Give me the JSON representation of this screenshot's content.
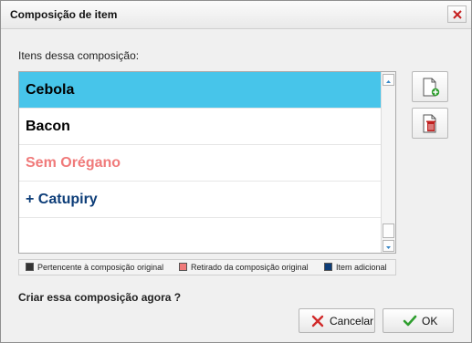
{
  "window": {
    "title": "Composição de item"
  },
  "list": {
    "caption": "Itens dessa composição:",
    "items": [
      {
        "label": "Cebola",
        "selected": true,
        "color": "#000000"
      },
      {
        "label": "Bacon",
        "selected": false,
        "color": "#000000"
      },
      {
        "label": "Sem Orégano",
        "selected": false,
        "color": "#f07a7a"
      },
      {
        "label": "+ Catupiry",
        "selected": false,
        "color": "#0d3d78"
      }
    ],
    "selected_color": "#47c5ea"
  },
  "legend": [
    {
      "label": "Pertencente à composição original",
      "color": "#333333"
    },
    {
      "label": "Retirado da composição original",
      "color": "#f07a7a"
    },
    {
      "label": "Item adicional",
      "color": "#0d3d78"
    }
  ],
  "side_buttons": {
    "add_icon": "add-document-icon",
    "remove_icon": "delete-document-icon"
  },
  "footer": {
    "question": "Criar essa composição agora ?",
    "cancel_label": "Cancelar",
    "ok_label": "OK",
    "cancel_icon": "red-x-icon",
    "ok_icon": "green-check-icon"
  }
}
